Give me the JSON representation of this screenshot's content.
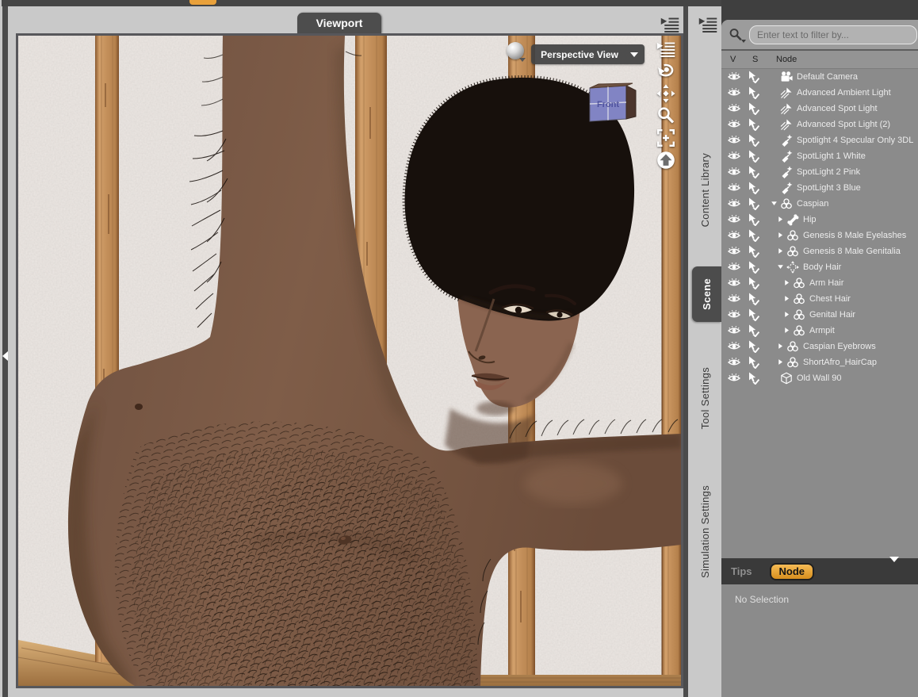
{
  "viewport": {
    "tab_label": "Viewport",
    "view_selector_label": "Perspective View",
    "view_cube_front_label": "Front",
    "tool_icons": [
      "pane-menu",
      "orbit",
      "pan",
      "dolly-zoom",
      "frame",
      "home"
    ]
  },
  "side_tabs": {
    "items": [
      {
        "label": "Content Library",
        "active": false
      },
      {
        "label": "Scene",
        "active": true
      },
      {
        "label": "Tool Settings",
        "active": false
      },
      {
        "label": "Simulation Settings",
        "active": false
      }
    ]
  },
  "scene_panel": {
    "filter": {
      "placeholder": "Enter text to filter by..."
    },
    "columns": [
      "V",
      "S",
      "Node"
    ],
    "tree": [
      {
        "label": "Default Camera",
        "icon": "camera",
        "depth": 0,
        "arrow": null
      },
      {
        "label": "Advanced Ambient Light",
        "icon": "light",
        "depth": 0,
        "arrow": null
      },
      {
        "label": "Advanced Spot Light",
        "icon": "light",
        "depth": 0,
        "arrow": null
      },
      {
        "label": "Advanced Spot Light (2)",
        "icon": "light",
        "depth": 0,
        "arrow": null
      },
      {
        "label": "Spotlight 4 Specular Only 3DL",
        "icon": "spotlight",
        "depth": 0,
        "arrow": null
      },
      {
        "label": "SpotLight 1 White",
        "icon": "spotlight",
        "depth": 0,
        "arrow": null
      },
      {
        "label": "SpotLight 2 Pink",
        "icon": "spotlight",
        "depth": 0,
        "arrow": null
      },
      {
        "label": "SpotLight 3 Blue",
        "icon": "spotlight",
        "depth": 0,
        "arrow": null
      },
      {
        "label": "Caspian",
        "icon": "figure",
        "depth": 0,
        "arrow": "down"
      },
      {
        "label": "Hip",
        "icon": "bone",
        "depth": 1,
        "arrow": "right"
      },
      {
        "label": "Genesis 8 Male Eyelashes",
        "icon": "figure",
        "depth": 1,
        "arrow": "right"
      },
      {
        "label": "Genesis 8 Male Genitalia",
        "icon": "figure",
        "depth": 1,
        "arrow": "right"
      },
      {
        "label": "Body Hair",
        "icon": "fit",
        "depth": 1,
        "arrow": "down"
      },
      {
        "label": "Arm Hair",
        "icon": "figure",
        "depth": 2,
        "arrow": "right"
      },
      {
        "label": "Chest Hair",
        "icon": "figure",
        "depth": 2,
        "arrow": "right"
      },
      {
        "label": "Genital Hair",
        "icon": "figure",
        "depth": 2,
        "arrow": "right"
      },
      {
        "label": "Armpit",
        "icon": "figure",
        "depth": 2,
        "arrow": "right"
      },
      {
        "label": "Caspian Eyebrows",
        "icon": "figure",
        "depth": 1,
        "arrow": "right"
      },
      {
        "label": "ShortAfro_HairCap",
        "icon": "figure",
        "depth": 1,
        "arrow": "right"
      },
      {
        "label": "Old Wall 90",
        "icon": "cube",
        "depth": 0,
        "arrow": null
      }
    ]
  },
  "bottom_panel": {
    "tips_label": "Tips",
    "node_label": "Node",
    "content": "No Selection"
  },
  "colors": {
    "accent_orange": "#e9a13b",
    "chrome_gray": "#c9c9c9",
    "dark_chrome": "#4b4b4b",
    "panel_gray": "#8b8b8b",
    "wall": "#e9e4e0",
    "wood": "#c9975f",
    "skin": "#7b5a45"
  }
}
